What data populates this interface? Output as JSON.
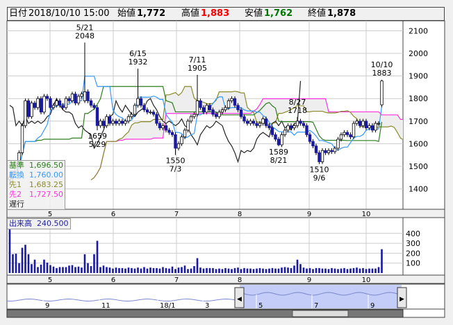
{
  "header": {
    "date_label": "日付",
    "date": "2018/10/10 15:00",
    "open_label": "始値",
    "open": "1,772",
    "high_label": "高値",
    "high": "1,883",
    "low_label": "安値",
    "low": "1,762",
    "close_label": "終値",
    "close": "1,878"
  },
  "colors": {
    "up": "#ffffff",
    "down": "#1a1aa0",
    "tenkan": "#3399ff",
    "kijun": "#2e7d1e",
    "senkouA": "#8a8a2a",
    "senkouB": "#ff33dd",
    "chikou": "#222222",
    "high_text": "#ff0000",
    "low_text": "#008000"
  },
  "legend": {
    "items": [
      {
        "label": "基準",
        "value": "1,696.50",
        "color": "#2e7d1e"
      },
      {
        "label": "転換",
        "value": "1,760.00",
        "color": "#3399ff"
      },
      {
        "label": "先1",
        "value": "1,683.25",
        "color": "#8a8a2a"
      },
      {
        "label": "先2",
        "value": "1,727.50",
        "color": "#ff33dd"
      },
      {
        "label": "遅行",
        "value": "",
        "color": "#222222"
      }
    ]
  },
  "volume_label": {
    "label": "出来高",
    "value": "240.500"
  },
  "price_axis": {
    "ticks": [
      2100,
      2000,
      1900,
      1800,
      1700,
      1600,
      1500,
      1400
    ],
    "range": [
      1330,
      2140
    ]
  },
  "volume_axis": {
    "ticks": [
      400,
      300,
      200,
      100
    ]
  },
  "months": [
    "5",
    "6",
    "7",
    "8",
    "9",
    "10"
  ],
  "annotations": [
    {
      "lines": [
        "5/21",
        "2048"
      ]
    },
    {
      "lines": [
        "1659",
        "5/29"
      ]
    },
    {
      "lines": [
        "6/15",
        "1932"
      ]
    },
    {
      "lines": [
        "1550",
        "7/3"
      ]
    },
    {
      "lines": [
        "7/11",
        "1905"
      ]
    },
    {
      "lines": [
        "1589",
        "8/21"
      ]
    },
    {
      "lines": [
        "8/27",
        "1718"
      ]
    },
    {
      "lines": [
        "1510",
        "9/6"
      ]
    },
    {
      "lines": [
        "10/10",
        "1883"
      ]
    }
  ],
  "navigator": {
    "labels": [
      "9",
      "11",
      "18/1",
      "3",
      "5",
      "7",
      "9"
    ]
  },
  "chart_data": {
    "type": "candlestick",
    "closes": [
      1450,
      1470,
      1510,
      1560,
      1680,
      1790,
      1720,
      1780,
      1760,
      1800,
      1740,
      1810,
      1800,
      1760,
      1770,
      1790,
      1770,
      1760,
      1800,
      1790,
      1820,
      1780,
      1810,
      1820,
      1830,
      1790,
      1770,
      1760,
      1680,
      1700,
      1680,
      1720,
      1690,
      1700,
      1690,
      1700,
      1690,
      1700,
      1720,
      1730,
      1770,
      1800,
      1770,
      1750,
      1740,
      1740,
      1730,
      1690,
      1670,
      1680,
      1660,
      1650,
      1640,
      1580,
      1600,
      1630,
      1660,
      1700,
      1720,
      1730,
      1790,
      1760,
      1740,
      1770,
      1750,
      1730,
      1720,
      1740,
      1750,
      1760,
      1790,
      1800,
      1770,
      1750,
      1720,
      1700,
      1690,
      1700,
      1690,
      1680,
      1690,
      1710,
      1680,
      1670,
      1640,
      1620,
      1595,
      1640,
      1660,
      1680,
      1670,
      1680,
      1700,
      1690,
      1680,
      1640,
      1610,
      1590,
      1560,
      1520,
      1570,
      1560,
      1570,
      1565,
      1580,
      1620,
      1640,
      1650,
      1640,
      1630,
      1690,
      1700,
      1680,
      1700,
      1670,
      1680,
      1660,
      1690,
      1690,
      1878
    ],
    "overrides": {
      "0": {
        "o": 1440,
        "l": 1420
      },
      "24": {
        "h": 2048,
        "o": 1790
      },
      "28": {
        "l": 1659
      },
      "41": {
        "h": 1932
      },
      "53": {
        "l": 1550
      },
      "60": {
        "h": 1905
      },
      "86": {
        "l": 1589
      },
      "92": {
        "h": 1718
      },
      "99": {
        "l": 1510
      },
      "119": {
        "o": 1772,
        "h": 1883,
        "l": 1762
      }
    },
    "volumes": [
      440,
      190,
      195,
      100,
      255,
      285,
      190,
      90,
      135,
      60,
      85,
      135,
      105,
      80,
      65,
      50,
      60,
      60,
      60,
      75,
      80,
      60,
      65,
      55,
      190,
      100,
      70,
      190,
      325,
      60,
      75,
      60,
      55,
      45,
      55,
      50,
      50,
      45,
      55,
      50,
      45,
      55,
      45,
      60,
      45,
      55,
      50,
      50,
      45,
      60,
      50,
      45,
      65,
      40,
      55,
      60,
      75,
      40,
      45,
      70,
      150,
      55,
      45,
      50,
      50,
      50,
      40,
      45,
      40,
      50,
      45,
      40,
      50,
      55,
      40,
      50,
      45,
      45,
      40,
      45,
      50,
      45,
      40,
      45,
      50,
      45,
      45,
      55,
      60,
      55,
      50,
      75,
      135,
      90,
      55,
      45,
      50,
      40,
      50,
      50,
      45,
      45,
      40,
      50,
      45,
      40,
      45,
      50,
      40,
      45,
      50,
      55,
      45,
      50,
      40,
      45,
      45,
      45,
      60,
      240.5
    ],
    "key_points": [
      {
        "date": "5/21",
        "value": 2048
      },
      {
        "date": "5/29",
        "value": 1659
      },
      {
        "date": "6/15",
        "value": 1932
      },
      {
        "date": "7/3",
        "value": 1550
      },
      {
        "date": "7/11",
        "value": 1905
      },
      {
        "date": "8/21",
        "value": 1589
      },
      {
        "date": "8/27",
        "value": 1718
      },
      {
        "date": "9/6",
        "value": 1510
      },
      {
        "date": "10/10",
        "value": 1883
      }
    ]
  }
}
